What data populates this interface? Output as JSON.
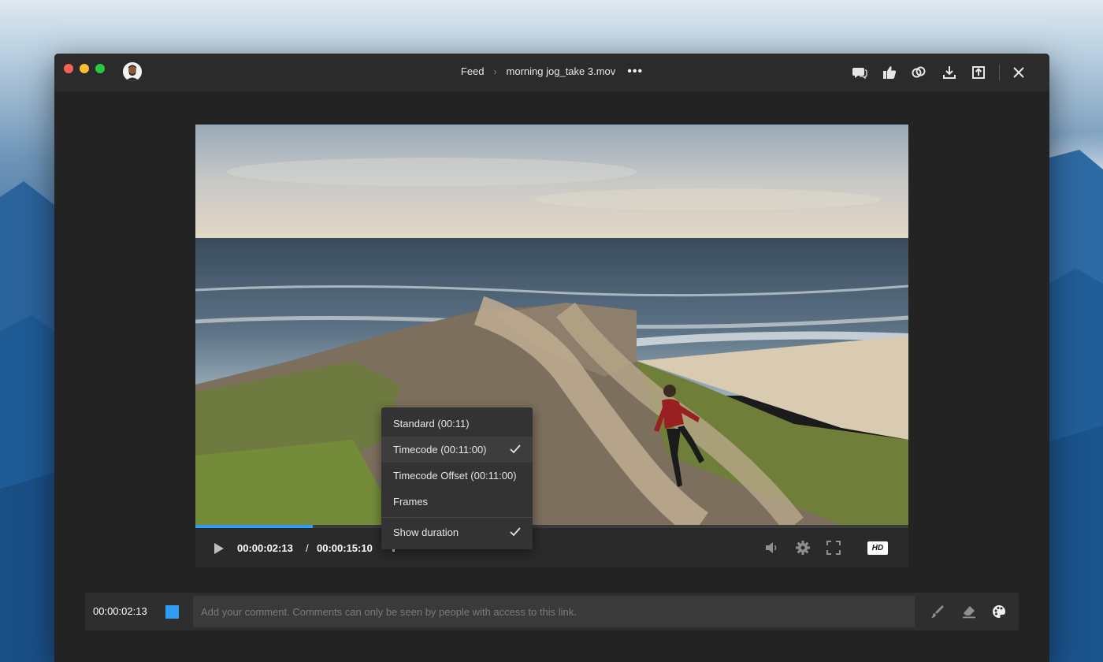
{
  "window": {
    "breadcrumb": {
      "parent": "Feed",
      "separator": "›",
      "file": "morning jog_take 3.mov",
      "more": "•••"
    }
  },
  "toolbar_icons": [
    "comment-icon",
    "thumbs-up-icon",
    "link-icon",
    "download-icon",
    "share-upload-icon",
    "close-icon"
  ],
  "player": {
    "current_time": "00:00:02:13",
    "time_separator": "/",
    "duration": "00:00:15:10",
    "progress_fraction": 0.165,
    "quality_badge": "HD",
    "progress_color": "#2f9bf2"
  },
  "time_format_menu": {
    "items": [
      {
        "label": "Standard (00:11)",
        "checked": false
      },
      {
        "label": "Timecode (00:11:00)",
        "checked": true
      },
      {
        "label": "Timecode Offset (00:11:00)",
        "checked": false
      },
      {
        "label": "Frames",
        "checked": false
      }
    ],
    "toggle": {
      "label": "Show duration",
      "checked": true
    }
  },
  "comment": {
    "timestamp": "00:00:02:13",
    "placeholder": "Add your comment. Comments can only be seen by people with access to this link.",
    "swatch_color": "#2f9bf2"
  }
}
